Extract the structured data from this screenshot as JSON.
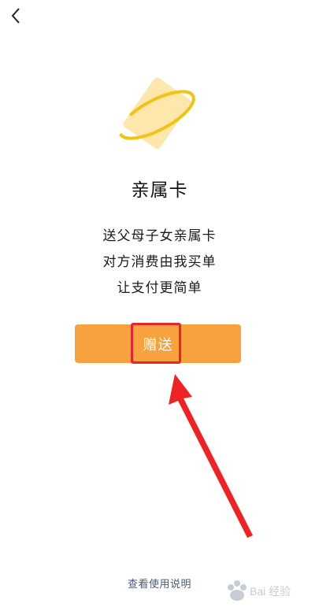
{
  "nav": {
    "back_icon": "chevron-left-icon"
  },
  "hero": {
    "icon": "card-ring-icon",
    "colors": {
      "card": "#fde7ab",
      "ring": "#f2c315"
    }
  },
  "title": "亲属卡",
  "description": [
    "送父母子女亲属卡",
    "对方消费由我买单",
    "让支付更简单"
  ],
  "primary_button": {
    "label": "赠送",
    "color": "#f7a23e",
    "highlight_color": "#e8232b"
  },
  "footer": {
    "help_link": "查看使用说明"
  },
  "annotation": {
    "arrow_color": "#ef2323"
  }
}
